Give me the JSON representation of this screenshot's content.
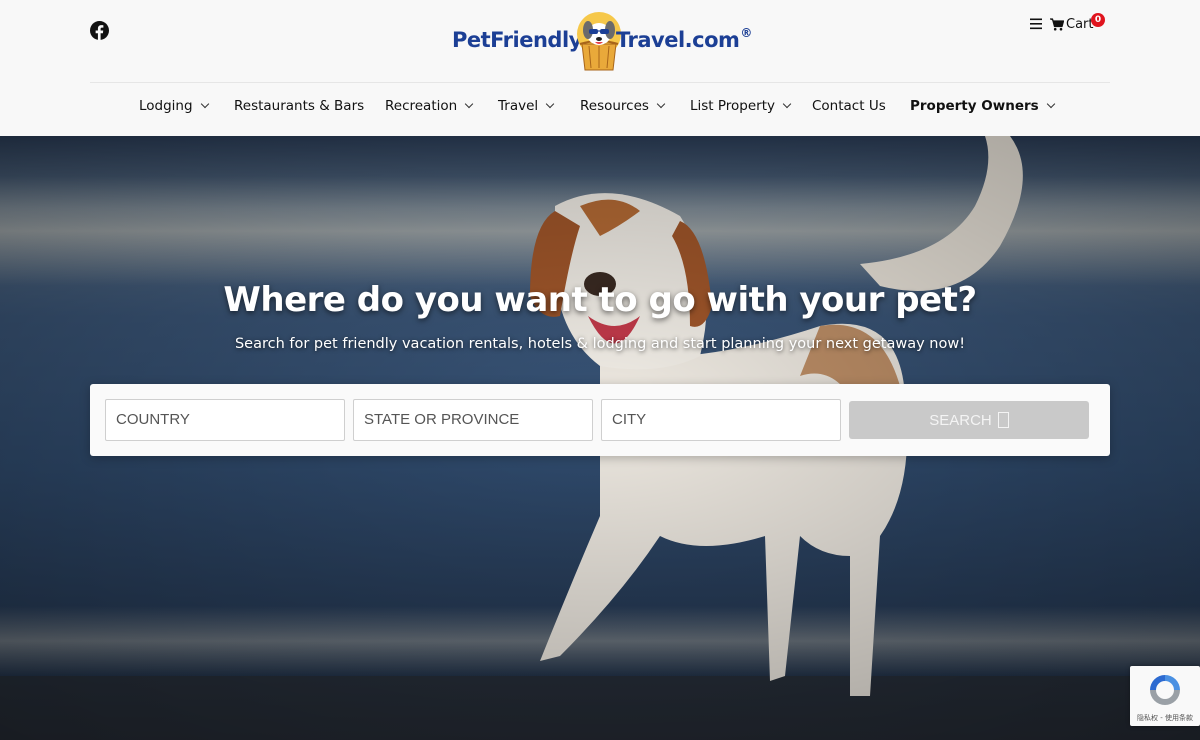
{
  "header": {
    "logo": {
      "left": "PetFriendly",
      "right": "Travel.com",
      "registered": "®"
    },
    "cart": {
      "label": "Cart",
      "count": "0"
    }
  },
  "nav": {
    "items": [
      {
        "label": "Lodging",
        "dropdown": true
      },
      {
        "label": "Restaurants & Bars",
        "dropdown": false
      },
      {
        "label": "Recreation",
        "dropdown": true
      },
      {
        "label": "Travel",
        "dropdown": true
      },
      {
        "label": "Resources",
        "dropdown": true
      },
      {
        "label": "List Property",
        "dropdown": true
      },
      {
        "label": "Contact Us",
        "dropdown": false
      },
      {
        "label": "Property Owners",
        "dropdown": true
      }
    ]
  },
  "hero": {
    "title": "Where do you want to go with your pet?",
    "subtitle": "Search for pet friendly vacation rentals, hotels & lodging and start planning your next getaway now!"
  },
  "search": {
    "country_placeholder": "COUNTRY",
    "state_placeholder": "STATE OR PROVINCE",
    "city_placeholder": "CITY",
    "button_label": "SEARCH"
  },
  "recaptcha": {
    "text": "隐私权 - 使用条款"
  },
  "colors": {
    "brand_blue": "#1c3f95",
    "badge_red": "#e0141e",
    "search_button": "#c9c9c9"
  },
  "icons": {
    "social": "facebook-icon",
    "menu": "hamburger-menu-icon",
    "cart": "shopping-cart-icon",
    "search_button": "search-icon",
    "captcha": "recaptcha-icon"
  }
}
